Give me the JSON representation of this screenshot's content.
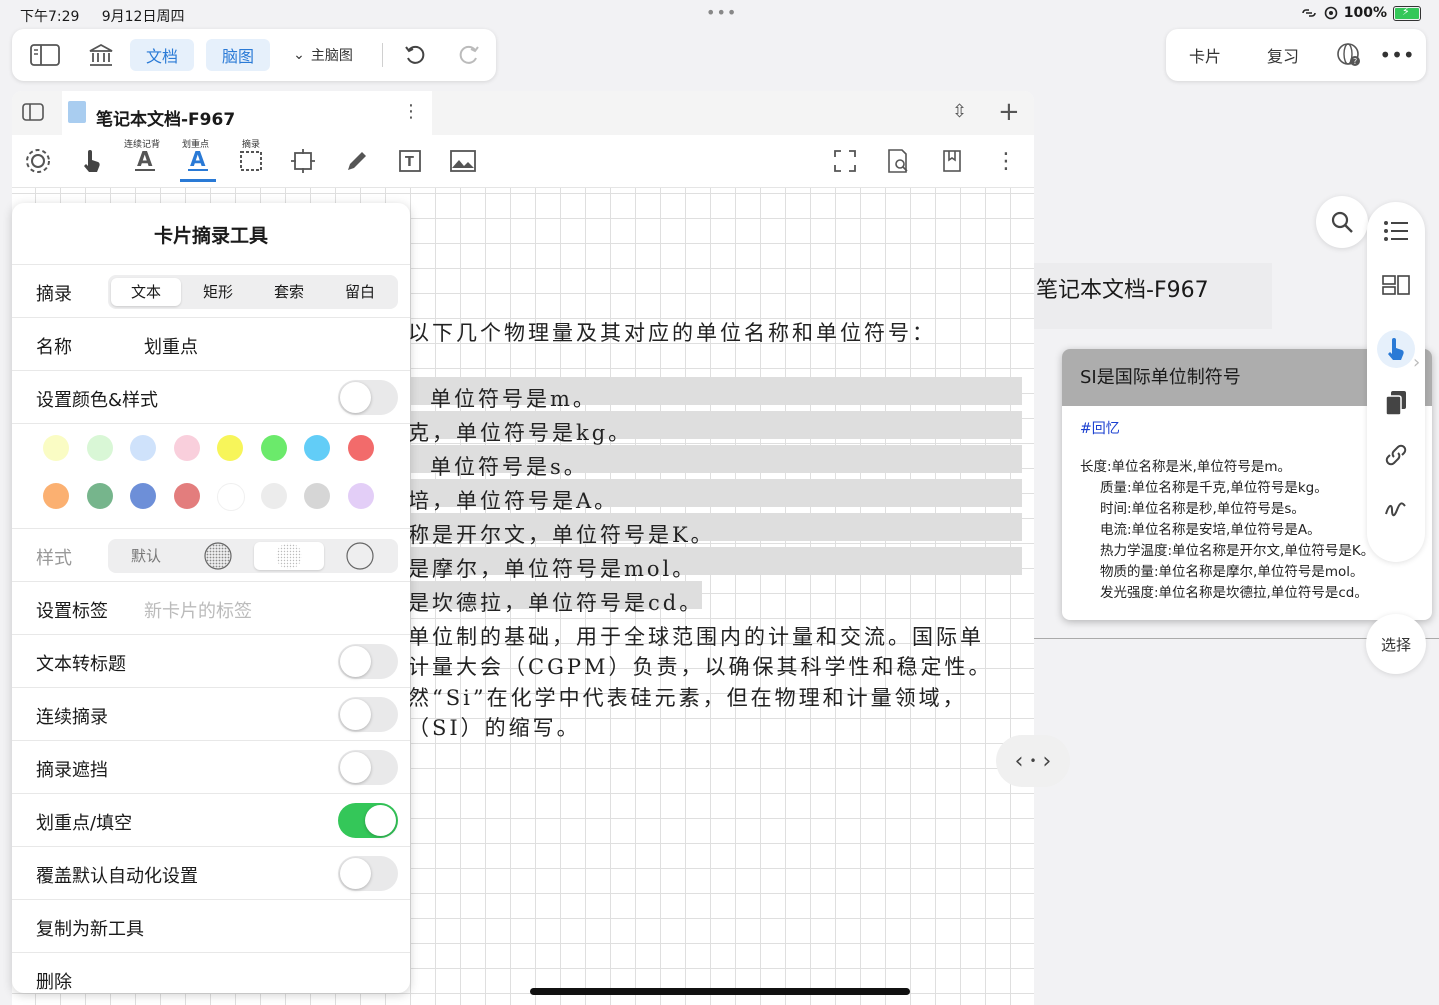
{
  "status": {
    "time": "下午7:29",
    "date": "9月12日周四",
    "battery": "100%"
  },
  "topbar": {
    "doc_label": "文档",
    "mindmap_label": "脑图",
    "main_mindmap_label": "主脑图"
  },
  "topbar_right": {
    "cards_label": "卡片",
    "review_label": "复习"
  },
  "doc": {
    "title": "笔记本文档-F967"
  },
  "tools": {
    "continuous_label": "连续记背",
    "highlight_label": "划重点",
    "excerpt_label": "摘录"
  },
  "sheet": {
    "title": "卡片摘录工具",
    "excerpt_label": "摘录",
    "modes": [
      "文本",
      "矩形",
      "套索",
      "留白"
    ],
    "name_label": "名称",
    "name_value": "划重点",
    "color_style_label": "设置颜色&样式",
    "swatch_colors": [
      "#fafcc4",
      "#d9f7d6",
      "#cfe2fb",
      "#f9cfdc",
      "#f7f55a",
      "#6bea6b",
      "#62cdf7",
      "#f26b6b",
      "#fbb071",
      "#76b58c",
      "#6d8fd8",
      "#e37d7d",
      "#ffffff",
      "#ececec",
      "#d6d6d6",
      "#e3cef7"
    ],
    "style_label": "样式",
    "style_default": "默认",
    "tag_label": "设置标签",
    "tag_placeholder": "新卡片的标签",
    "text_to_title_label": "文本转标题",
    "continuous_excerpt_label": "连续摘录",
    "excerpt_mask_label": "摘录遮挡",
    "highlight_fill_label": "划重点/填空",
    "override_label": "覆盖默认自动化设置",
    "copy_label": "复制为新工具",
    "delete_label": "删除"
  },
  "note_lines": [
    "以下几个物理量及其对应的单位名称和单位符号：",
    "单位符号是m。",
    "克，单位符号是kg。",
    "单位符号是s。",
    "培，单位符号是A。",
    "称是开尔文，单位符号是K。",
    "是摩尔，单位符号是mol。",
    "是坎德拉，单位符号是cd。",
    "单位制的基础，用于全球范围内的计量和交流。国际单",
    "计量大会（CGPM）负责，以确保其科学性和稳定性。",
    "然“Si”在化学中代表硅元素，但在物理和计量领域，",
    "（SI）的缩写。"
  ],
  "right_panel": {
    "doc_title": "笔记本文档-F967",
    "card_title": "SI是国际单位制符号",
    "card_tag": "#回忆",
    "card_lines": [
      "长度:单位名称是米,单位符号是m。",
      "质量:单位名称是千克,单位符号是kg。",
      "时间:单位名称是秒,单位符号是s。",
      "电流:单位名称是安培,单位符号是A。",
      "热力学温度:单位名称是开尔文,单位符号是K。",
      "物质的量:单位名称是摩尔,单位符号是mol。",
      "发光强度:单位名称是坎德拉,单位符号是cd。"
    ],
    "select_label": "选择"
  }
}
